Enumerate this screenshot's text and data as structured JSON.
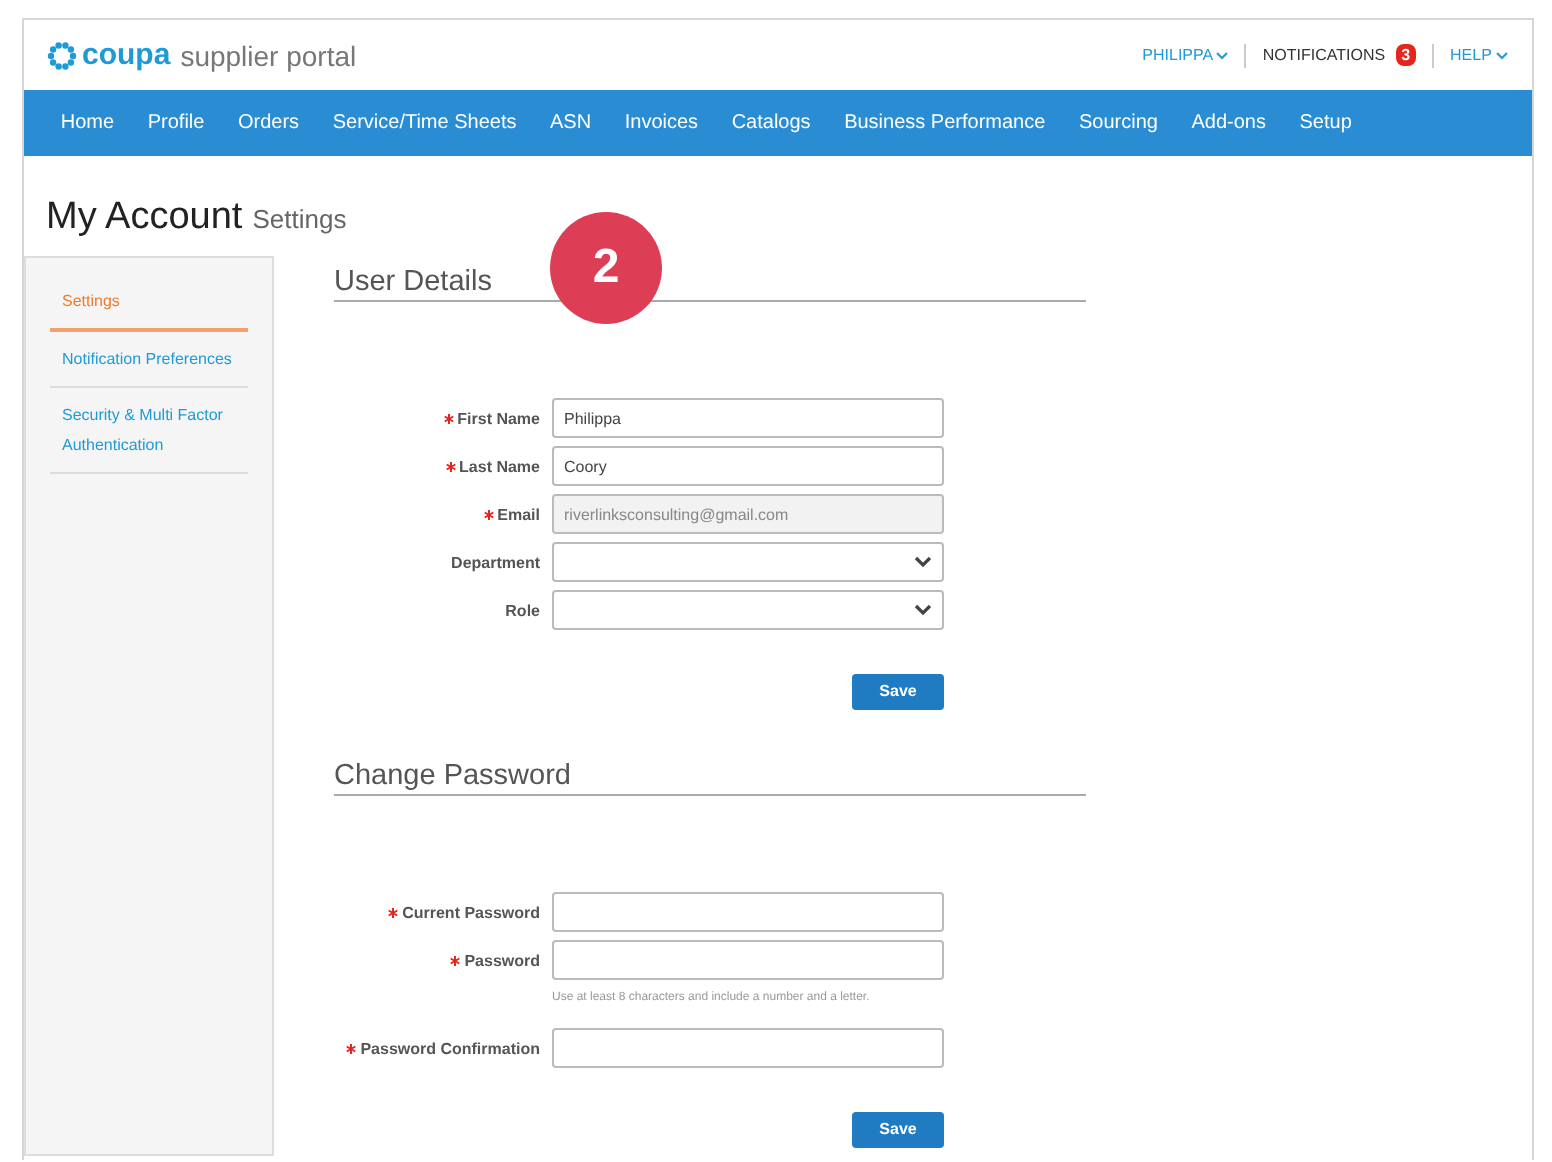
{
  "header": {
    "logo_brand": "coupa",
    "logo_product": "supplier portal",
    "user_menu": "PHILIPPA",
    "notifications": {
      "label": "NOTIFICATIONS",
      "count": "3"
    },
    "help_menu": "HELP"
  },
  "nav": [
    "Home",
    "Profile",
    "Orders",
    "Service/Time Sheets",
    "ASN",
    "Invoices",
    "Catalogs",
    "Business Performance",
    "Sourcing",
    "Add-ons",
    "Setup"
  ],
  "page_title": {
    "main": "My Account",
    "sub": "Settings"
  },
  "sidebar": {
    "items": [
      {
        "label": "Settings",
        "selected": true
      },
      {
        "label": "Notification Preferences",
        "selected": false
      },
      {
        "label": "Security & Multi Factor Authentication",
        "selected": false
      }
    ]
  },
  "step_badge": "2",
  "sections": [
    {
      "title": "User Details",
      "fields": [
        {
          "kind": "text",
          "label": "First Name",
          "required": true,
          "value": "Philippa",
          "disabled": false
        },
        {
          "kind": "text",
          "label": "Last Name",
          "required": true,
          "value": "Coory",
          "disabled": false
        },
        {
          "kind": "text",
          "label": "Email",
          "required": true,
          "value": "riverlinksconsulting@gmail.com",
          "disabled": true
        },
        {
          "kind": "select",
          "label": "Department",
          "required": false,
          "disabled": false
        },
        {
          "kind": "select",
          "label": "Role",
          "required": false,
          "disabled": false
        }
      ],
      "button": "Save"
    },
    {
      "title": "Change Password",
      "fields": [
        {
          "kind": "text",
          "label": "Current Password",
          "required": true,
          "disabled": false
        },
        {
          "kind": "text",
          "label": "Password",
          "required": true,
          "disabled": false,
          "hint": "Use at least 8 characters and include a number and a letter."
        },
        {
          "kind": "text",
          "label": "Password Confirmation",
          "required": true,
          "disabled": false
        }
      ],
      "button": "Save"
    }
  ]
}
